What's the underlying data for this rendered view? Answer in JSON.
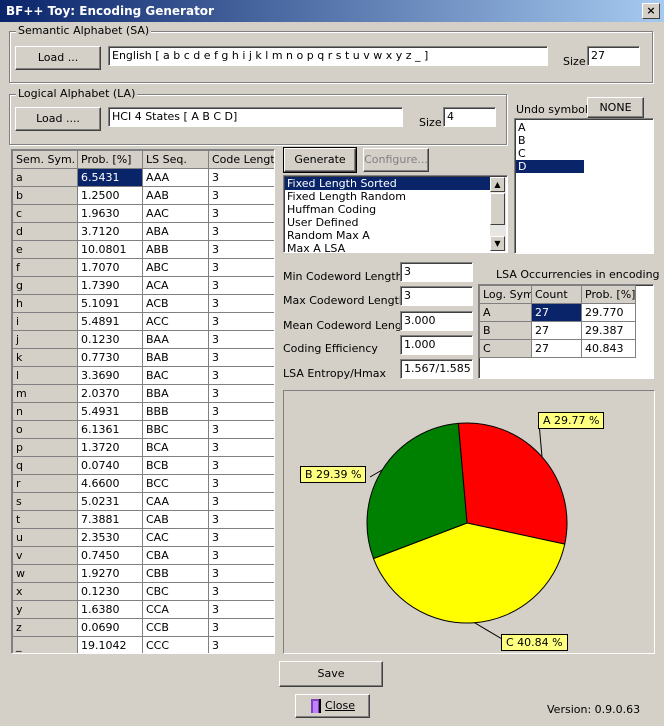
{
  "window": {
    "title": "BF++ Toy: Encoding Generator",
    "close_glyph": "×"
  },
  "semantic": {
    "group_label": "Semantic Alphabet (SA)",
    "load_label": "Load ...",
    "value": "English [ a b c d e f g h i j k l m n o p q r s t u v w x y z _ ]",
    "size_label": "Size",
    "size_value": "27"
  },
  "logical": {
    "group_label": "Logical Alphabet (LA)",
    "load_label": "Load ....",
    "value": "HCI 4 States [ A B C D]",
    "size_label": "Size",
    "size_value": "4"
  },
  "undo": {
    "label": "Undo symbol",
    "button_label": "NONE",
    "items": [
      "A",
      "B",
      "C",
      "D"
    ],
    "selected_index": 3
  },
  "table": {
    "headers": [
      "Sem. Sym.",
      "Prob. [%]",
      "LS Seq.",
      "Code Length"
    ],
    "selected_row": 0,
    "rows": [
      [
        "a",
        "6.5431",
        "AAA",
        "3"
      ],
      [
        "b",
        "1.2500",
        "AAB",
        "3"
      ],
      [
        "c",
        "1.9630",
        "AAC",
        "3"
      ],
      [
        "d",
        "3.7120",
        "ABA",
        "3"
      ],
      [
        "e",
        "10.0801",
        "ABB",
        "3"
      ],
      [
        "f",
        "1.7070",
        "ABC",
        "3"
      ],
      [
        "g",
        "1.7390",
        "ACA",
        "3"
      ],
      [
        "h",
        "5.1091",
        "ACB",
        "3"
      ],
      [
        "i",
        "5.4891",
        "ACC",
        "3"
      ],
      [
        "j",
        "0.1230",
        "BAA",
        "3"
      ],
      [
        "k",
        "0.7730",
        "BAB",
        "3"
      ],
      [
        "l",
        "3.3690",
        "BAC",
        "3"
      ],
      [
        "m",
        "2.0370",
        "BBA",
        "3"
      ],
      [
        "n",
        "5.4931",
        "BBB",
        "3"
      ],
      [
        "o",
        "6.1361",
        "BBC",
        "3"
      ],
      [
        "p",
        "1.3720",
        "BCA",
        "3"
      ],
      [
        "q",
        "0.0740",
        "BCB",
        "3"
      ],
      [
        "r",
        "4.6600",
        "BCC",
        "3"
      ],
      [
        "s",
        "5.0231",
        "CAA",
        "3"
      ],
      [
        "t",
        "7.3881",
        "CAB",
        "3"
      ],
      [
        "u",
        "2.3530",
        "CAC",
        "3"
      ],
      [
        "v",
        "0.7450",
        "CBA",
        "3"
      ],
      [
        "w",
        "1.9270",
        "CBB",
        "3"
      ],
      [
        "x",
        "0.1230",
        "CBC",
        "3"
      ],
      [
        "y",
        "1.6380",
        "CCA",
        "3"
      ],
      [
        "z",
        "0.0690",
        "CCB",
        "3"
      ],
      [
        "_",
        "19.1042",
        "CCC",
        "3"
      ]
    ]
  },
  "generate": {
    "label": "Generate"
  },
  "configure": {
    "label": "Configure..."
  },
  "methods": {
    "items": [
      "Fixed Length Sorted",
      "Fixed Length Random",
      "Huffman Coding",
      "User Defined",
      "Random Max A",
      "Max A LSA"
    ],
    "selected_index": 0,
    "scroll_up_glyph": "▲",
    "scroll_down_glyph": "▼"
  },
  "stats": [
    {
      "label": "Min Codeword Length",
      "value": "3"
    },
    {
      "label": "Max Codeword Length",
      "value": "3"
    },
    {
      "label": "Mean Codeword Length",
      "value": "3.000"
    },
    {
      "label": "Coding Efficiency",
      "value": "1.000"
    },
    {
      "label": "LSA Entropy/Hmax",
      "value": "1.567/1.585"
    }
  ],
  "lsa": {
    "title": "LSA Occurrencies in encoding",
    "headers": [
      "Log. Sym.",
      "Count",
      "Prob. [%]"
    ],
    "rows": [
      [
        "A",
        "27",
        "29.770"
      ],
      [
        "B",
        "27",
        "29.387"
      ],
      [
        "C",
        "27",
        "40.843"
      ]
    ]
  },
  "chart_data": {
    "type": "pie",
    "slices": [
      {
        "name": "A",
        "value": 29.77,
        "label": "A 29.77 %",
        "color": "#ff0000"
      },
      {
        "name": "B",
        "value": 29.39,
        "label": "B 29.39 %",
        "color": "#008000"
      },
      {
        "name": "C",
        "value": 40.84,
        "label": "C 40.84 %",
        "color": "#ffff00"
      }
    ]
  },
  "footer": {
    "save_label": "Save",
    "close_label": "Close",
    "version": "Version: 0.9.0.63"
  }
}
